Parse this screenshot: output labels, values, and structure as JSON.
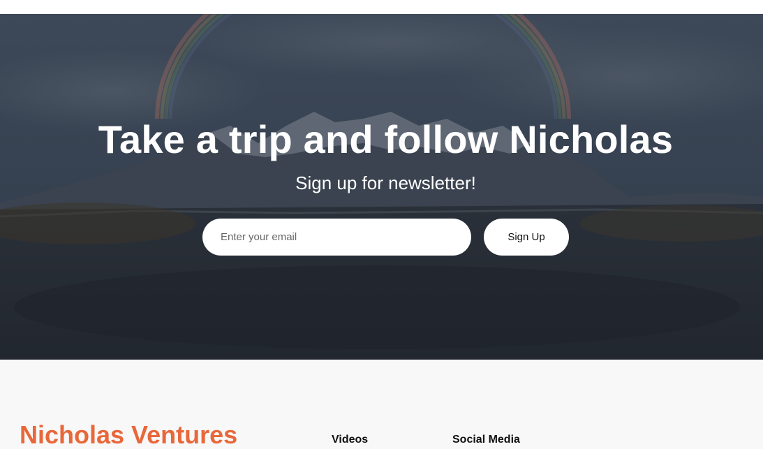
{
  "hero": {
    "title": "Take a trip and follow Nicholas",
    "subtitle": "Sign up for newsletter!",
    "email_placeholder": "Enter your email",
    "signup_label": "Sign Up"
  },
  "footer": {
    "brand": "Nicholas Ventures",
    "columns": [
      {
        "heading": "Videos"
      },
      {
        "heading": "Social Media"
      }
    ]
  },
  "colors": {
    "brand": "#e8683a",
    "hero_overlay": "#2e3947",
    "footer_bg": "#f8f8f8"
  }
}
